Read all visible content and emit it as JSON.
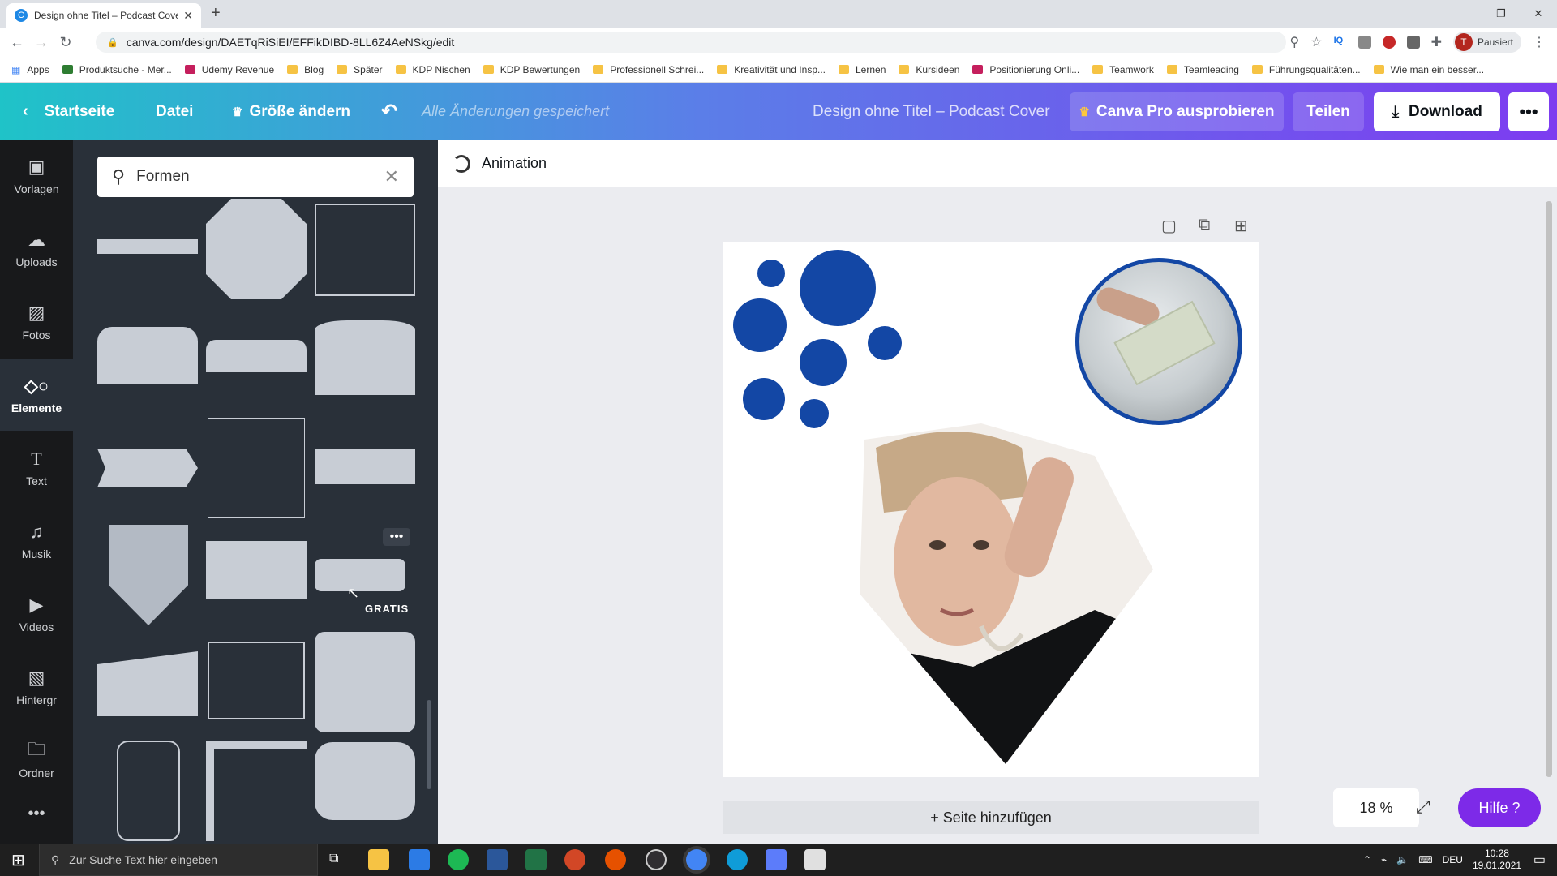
{
  "browser": {
    "tab_title": "Design ohne Titel – Podcast Cove",
    "url": "canva.com/design/DAETqRiSiEI/EFFikDIBD-8LL6Z4AeNSkg/edit",
    "profile_label": "Pausiert",
    "profile_initial": "T"
  },
  "bookmarks": [
    "Apps",
    "Produktsuche - Mer...",
    "Udemy Revenue",
    "Blog",
    "Später",
    "KDP Nischen",
    "KDP Bewertungen",
    "Professionell Schrei...",
    "Kreativität und Insp...",
    "Lernen",
    "Kursideen",
    "Positionierung Onli...",
    "Teamwork",
    "Teamleading",
    "Führungsqualitäten...",
    "Wie man ein besser..."
  ],
  "header": {
    "home": "Startseite",
    "file": "Datei",
    "resize": "Größe ändern",
    "saved_status": "Alle Änderungen gespeichert",
    "doc_title": "Design ohne Titel – Podcast Cover",
    "pro": "Canva Pro ausprobieren",
    "share": "Teilen",
    "download": "Download"
  },
  "leftnav": [
    {
      "label": "Vorlagen",
      "icon": "template-icon"
    },
    {
      "label": "Uploads",
      "icon": "upload-cloud-icon"
    },
    {
      "label": "Fotos",
      "icon": "photo-icon"
    },
    {
      "label": "Elemente",
      "icon": "shapes-icon"
    },
    {
      "label": "Text",
      "icon": "text-icon"
    },
    {
      "label": "Musik",
      "icon": "music-icon"
    },
    {
      "label": "Videos",
      "icon": "video-icon"
    },
    {
      "label": "Hintergr",
      "icon": "background-icon"
    },
    {
      "label": "Ordner",
      "icon": "folder-icon"
    }
  ],
  "panel": {
    "search_value": "Formen",
    "badge": "GRATIS"
  },
  "canvas": {
    "animation_label": "Animation",
    "add_page": "+ Seite hinzufügen",
    "zoom": "18 %",
    "help": "Hilfe ?",
    "accent_color": "#1347a5"
  },
  "taskbar": {
    "search_placeholder": "Zur Suche Text hier eingeben",
    "lang": "DEU",
    "time": "10:28",
    "date": "19.01.2021"
  }
}
